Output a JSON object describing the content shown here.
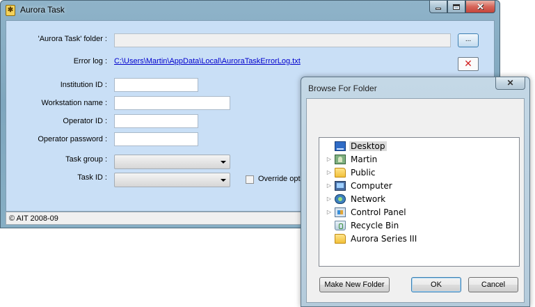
{
  "main_window": {
    "title": "Aurora Task",
    "icon": "aurora-app-icon",
    "caption_buttons": {
      "minimize": "minimize-icon",
      "maximize": "maximize-icon",
      "close": "✕"
    },
    "form": {
      "folder_label": "'Aurora Task' folder :",
      "folder_value": "",
      "browse_button": "...",
      "error_log_label": "Error log :",
      "error_log_link": "C:\\Users\\Martin\\AppData\\Local\\AuroraTaskErrorLog.txt",
      "clear_log_icon": "✕",
      "institution_label": "Institution ID :",
      "institution_value": "",
      "workstation_label": "Workstation name :",
      "workstation_value": "",
      "operator_id_label": "Operator ID :",
      "operator_id_value": "",
      "operator_password_label": "Operator password :",
      "operator_password_value": "",
      "task_group_label": "Task group :",
      "task_group_value": "",
      "task_id_label": "Task ID :",
      "task_id_value": "",
      "override_label": "Override optio",
      "override_checked": false
    },
    "status_bar": "© AIT 2008-09"
  },
  "browse_dialog": {
    "title": "Browse For Folder",
    "close_glyph": "✕",
    "tree": [
      {
        "label": "Desktop",
        "icon": "desktop-icon",
        "expandable": false,
        "selected": true
      },
      {
        "label": "Martin",
        "icon": "user-folder-icon",
        "expandable": true
      },
      {
        "label": "Public",
        "icon": "folder-icon",
        "expandable": true
      },
      {
        "label": "Computer",
        "icon": "computer-icon",
        "expandable": true
      },
      {
        "label": "Network",
        "icon": "network-icon",
        "expandable": true
      },
      {
        "label": "Control Panel",
        "icon": "control-panel-icon",
        "expandable": true
      },
      {
        "label": "Recycle Bin",
        "icon": "recycle-bin-icon",
        "expandable": false
      },
      {
        "label": "Aurora Series III",
        "icon": "folder-icon",
        "expandable": false
      }
    ],
    "buttons": {
      "make_new_folder": "Make New Folder",
      "ok": "OK",
      "cancel": "Cancel"
    }
  }
}
